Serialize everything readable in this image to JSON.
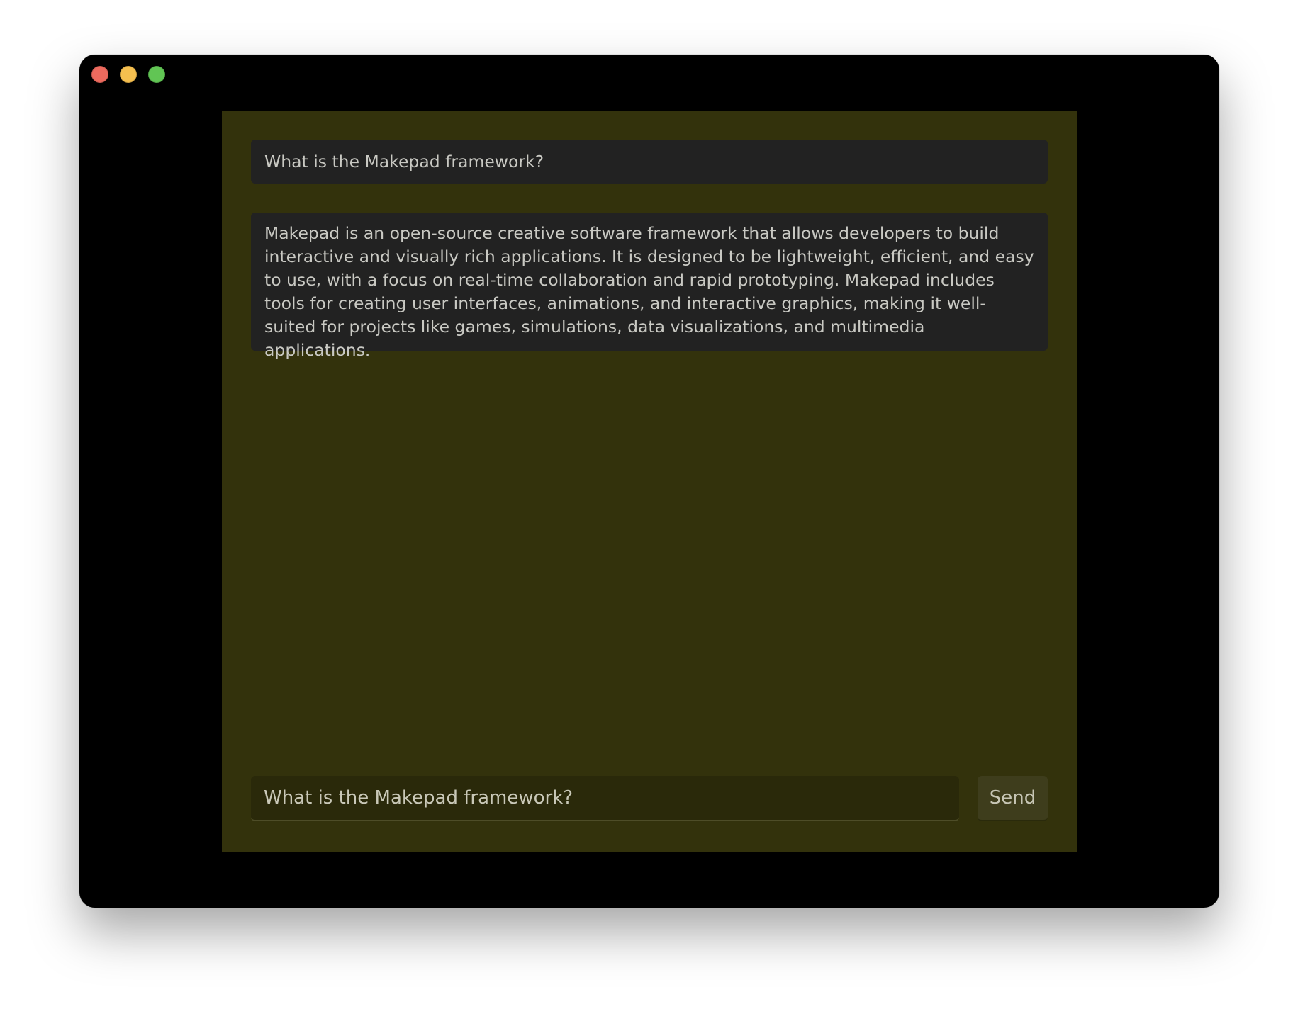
{
  "window": {
    "traffic_lights": [
      {
        "name": "close",
        "color": "#ed6a5e"
      },
      {
        "name": "minimize",
        "color": "#f5bf4f"
      },
      {
        "name": "maximize",
        "color": "#61c554"
      }
    ]
  },
  "chat": {
    "messages": [
      {
        "role": "user",
        "text": "What is the Makepad framework?"
      },
      {
        "role": "assistant",
        "text": "Makepad is an open-source creative software framework that allows developers to build interactive and visually rich applications. It is designed to be lightweight, efficient, and easy to use, with a focus on real-time collaboration and rapid prototyping. Makepad includes tools for creating user interfaces, animations, and interactive graphics, making it well-suited for projects like games, simulations, data visualizations, and multimedia applications."
      }
    ],
    "input_value": "What is the Makepad framework?",
    "send_label": "Send"
  },
  "colors": {
    "panel_background": "#33320c",
    "bubble_background": "#222222",
    "window_background": "#000000"
  }
}
